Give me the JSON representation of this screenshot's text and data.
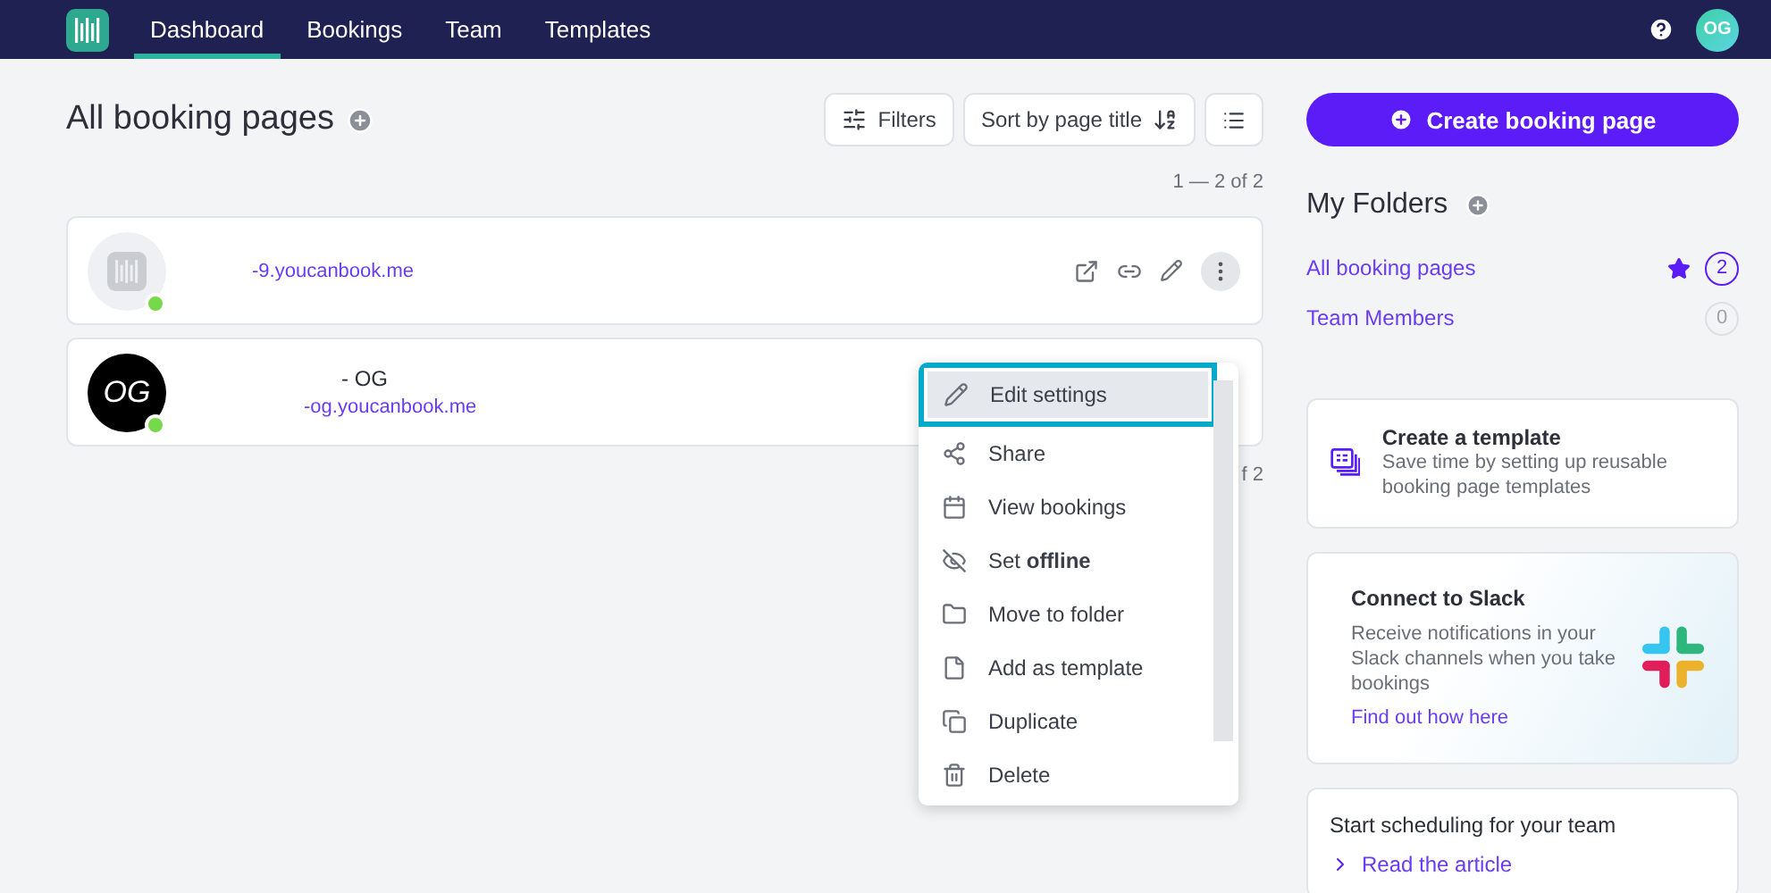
{
  "nav": {
    "tabs": [
      {
        "label": "Dashboard",
        "selected": true
      },
      {
        "label": "Bookings",
        "selected": false
      },
      {
        "label": "Team",
        "selected": false
      },
      {
        "label": "Templates",
        "selected": false
      }
    ],
    "avatar": "OG"
  },
  "header": {
    "title": "All booking pages",
    "filters": "Filters",
    "sort": "Sort by page title"
  },
  "pagination_top": "1 — 2 of 2",
  "pages": [
    {
      "kind": "logo",
      "url": "-9.youcanbook.me",
      "online": true,
      "actions": true
    },
    {
      "kind": "initials",
      "initials": "OG",
      "title": "- OG",
      "url": "-og.youcanbook.me",
      "online": true,
      "actions": false
    }
  ],
  "pagination_bottom": "f 2",
  "menu": [
    {
      "label": "Edit settings",
      "selected": true
    },
    {
      "label": "Share",
      "selected": false
    },
    {
      "label": "View bookings",
      "selected": false
    },
    {
      "label": "Set **offline**",
      "selected": false
    },
    {
      "label": "Move to folder",
      "selected": false
    },
    {
      "label": "Add as template",
      "selected": false
    },
    {
      "label": "Duplicate",
      "selected": false
    },
    {
      "label": "Delete",
      "selected": false
    }
  ],
  "create_button": "Create booking page",
  "folders": {
    "title": "My Folders",
    "items": [
      {
        "label": "All booking pages",
        "count": "2",
        "starred": true,
        "selected": true
      },
      {
        "label": "Team Members",
        "count": "0",
        "starred": false,
        "selected": false
      }
    ]
  },
  "template_card": {
    "title": "Create a template",
    "text": "Save time by setting up reusable booking page templates"
  },
  "slack_card": {
    "title": "Connect to Slack",
    "text": "Receive notifications in your Slack channels when you take bookings",
    "link": "Find out how here"
  },
  "article_card": {
    "title": "Start scheduling for your team",
    "link": "Read the article"
  }
}
